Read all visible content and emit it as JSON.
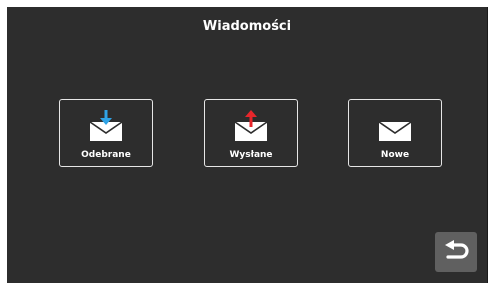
{
  "header": {
    "title": "Wiadomości"
  },
  "tiles": [
    {
      "label": "Odebrane",
      "icon": "envelope-received-icon",
      "arrow_color": "#2fa3e6"
    },
    {
      "label": "Wysłane",
      "icon": "envelope-sent-icon",
      "arrow_color": "#e8262b"
    },
    {
      "label": "Nowe",
      "icon": "envelope-new-icon"
    }
  ],
  "back_button": {
    "icon": "back-return-icon"
  }
}
